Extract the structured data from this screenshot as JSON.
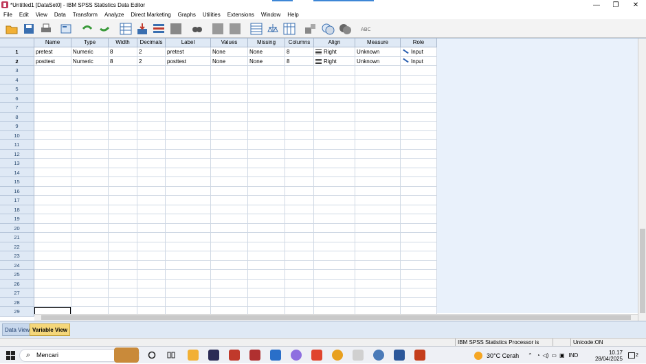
{
  "window": {
    "title": "*Untitled1 [DataSet0] - IBM SPSS Statistics Data Editor",
    "minimize": "—",
    "maximize": "❐",
    "close": "✕"
  },
  "menu": [
    "File",
    "Edit",
    "View",
    "Data",
    "Transform",
    "Analyze",
    "Direct Marketing",
    "Graphs",
    "Utilities",
    "Extensions",
    "Window",
    "Help"
  ],
  "toolbar_icons": [
    "open-folder-icon",
    "save-icon",
    "print-icon",
    "dialog-recall-icon",
    "undo-icon",
    "redo-icon",
    "goto-case-icon",
    "goto-variable-icon",
    "variables-icon",
    "split-file-icon",
    "find-icon",
    "insert-case-icon",
    "insert-variable-icon",
    "split-icon",
    "weight-cases-icon",
    "select-cases-icon",
    "value-labels-icon",
    "use-sets-icon",
    "show-all-icon",
    "spell-check-icon"
  ],
  "columns": [
    "Name",
    "Type",
    "Width",
    "Decimals",
    "Label",
    "Values",
    "Missing",
    "Columns",
    "Align",
    "Measure",
    "Role"
  ],
  "variables": [
    {
      "row": "1",
      "name": "pretest",
      "type": "Numeric",
      "width": "8",
      "decimals": "2",
      "label": "pretest",
      "values": "None",
      "missing": "None",
      "columns": "8",
      "align": "Right",
      "measure": "Unknown",
      "role": "Input"
    },
    {
      "row": "2",
      "name": "posttest",
      "type": "Numeric",
      "width": "8",
      "decimals": "2",
      "label": "posttest",
      "values": "None",
      "missing": "None",
      "columns": "8",
      "align": "Right",
      "measure": "Unknown",
      "role": "Input"
    }
  ],
  "empty_rows": [
    "3",
    "4",
    "5",
    "6",
    "7",
    "8",
    "9",
    "10",
    "11",
    "12",
    "13",
    "14",
    "15",
    "16",
    "17",
    "18",
    "19",
    "20",
    "21",
    "22",
    "23",
    "24",
    "25",
    "26",
    "27",
    "28",
    "29"
  ],
  "tabs": {
    "data_view": "Data View",
    "variable_view": "Variable View"
  },
  "status": {
    "processor": "IBM SPSS Statistics Processor is ready",
    "unicode": "Unicode:ON"
  },
  "taskbar": {
    "search_placeholder": "Mencari",
    "weather": "30°C  Cerah",
    "language": "IND",
    "time": "10.17",
    "date": "28/04/2025",
    "notifications": "2"
  },
  "colors": {
    "header_bg": "#dfe9f5",
    "right_pane": "#e9f1fb",
    "active_tab": "#f5d77a"
  }
}
